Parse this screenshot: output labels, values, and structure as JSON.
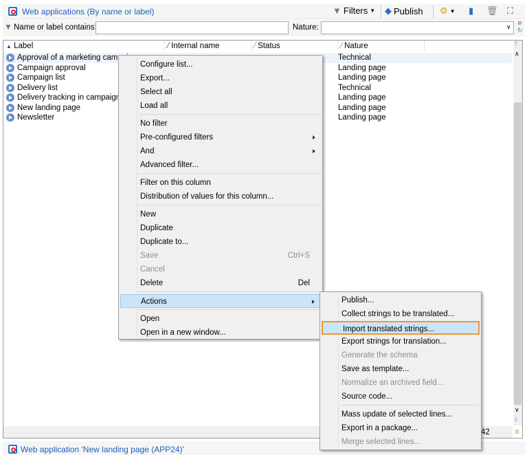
{
  "toolbar": {
    "title": "Web applications (By name or label)",
    "filters": "Filters",
    "publish": "Publish"
  },
  "filter": {
    "name_label": "Name or label contains:",
    "name_value": "",
    "nature_label": "Nature:",
    "nature_value": ""
  },
  "columns": [
    "Label",
    "Internal name",
    "Status",
    "Nature"
  ],
  "rows": [
    {
      "label": "Approval of a marketing campaign",
      "nature": "Technical"
    },
    {
      "label": "Campaign approval",
      "nature": "Landing page"
    },
    {
      "label": "Campaign list",
      "nature": "Landing page"
    },
    {
      "label": "Delivery list",
      "nature": "Technical"
    },
    {
      "label": "Delivery tracking in campaigns",
      "nature": "Landing page"
    },
    {
      "label": "New landing page",
      "nature": "Landing page"
    },
    {
      "label": "Newsletter",
      "nature": "Landing page"
    }
  ],
  "status": {
    "count": "42"
  },
  "bottom": {
    "title": "Web application 'New landing page (APP24)'"
  },
  "context_menu": [
    {
      "label": "Configure list..."
    },
    {
      "label": "Export..."
    },
    {
      "label": "Select all"
    },
    {
      "label": "Load all"
    },
    {
      "sep": true
    },
    {
      "label": "No filter"
    },
    {
      "label": "Pre-configured filters",
      "sub": true
    },
    {
      "label": "And",
      "sub": true
    },
    {
      "label": "Advanced filter..."
    },
    {
      "sep": true
    },
    {
      "label": "Filter on this column"
    },
    {
      "label": "Distribution of values for this column..."
    },
    {
      "sep": true
    },
    {
      "label": "New"
    },
    {
      "label": "Duplicate"
    },
    {
      "label": "Duplicate to..."
    },
    {
      "label": "Save",
      "shortcut": "Ctrl+S",
      "disabled": true
    },
    {
      "label": "Cancel",
      "disabled": true
    },
    {
      "label": "Delete",
      "shortcut": "Del"
    },
    {
      "sep": true
    },
    {
      "label": "Actions",
      "sub": true,
      "highlighted": true
    },
    {
      "sep": true
    },
    {
      "label": "Open"
    },
    {
      "label": "Open in a new window..."
    }
  ],
  "actions_menu": [
    {
      "label": "Publish..."
    },
    {
      "label": "Collect strings to be translated..."
    },
    {
      "label": "Import translated strings...",
      "highlighted": true
    },
    {
      "label": "Export strings for translation..."
    },
    {
      "label": "Generate the schema",
      "disabled": true
    },
    {
      "label": "Save as template..."
    },
    {
      "label": "Normalize an archived field...",
      "disabled": true
    },
    {
      "label": "Source code..."
    },
    {
      "sep": true
    },
    {
      "label": "Mass update of selected lines..."
    },
    {
      "label": "Export in a package..."
    },
    {
      "label": "Merge selected lines...",
      "disabled": true
    }
  ],
  "colors": {
    "accent": "#1f5fbf",
    "highlight": "#cce4f7",
    "focus_border": "#f0962e"
  }
}
